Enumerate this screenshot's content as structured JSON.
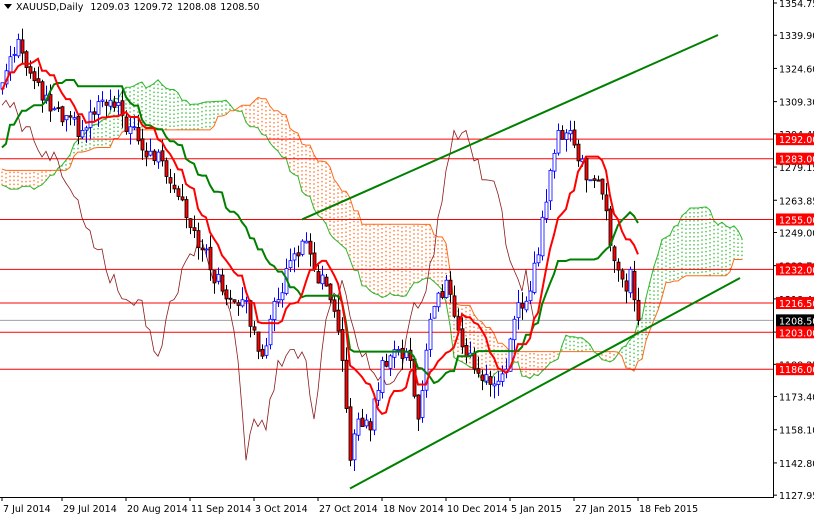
{
  "header": {
    "symbol": "XAUUSD,Daily",
    "open": "1209.03",
    "high": "1209.72",
    "low": "1208.08",
    "close": "1208.50"
  },
  "chart_data": {
    "type": "candlestick",
    "title": "XAUUSD,Daily",
    "indicator": "Ichimoku Kinko Hyo (9,26,52)",
    "ylim": [
      1127.95,
      1354.75
    ],
    "y_ticks": [
      "1354.75",
      "1339.90",
      "1324.60",
      "1309.30",
      "1294.45",
      "1279.15",
      "1263.85",
      "1249.00",
      "1233.70",
      "1218.40",
      "1203.10",
      "1188.25",
      "1173.40",
      "1158.10",
      "1142.80",
      "1127.95"
    ],
    "x_ticks": [
      {
        "bar": 0,
        "label": "7 Jul 2014"
      },
      {
        "bar": 15,
        "label": "29 Jul 2014"
      },
      {
        "bar": 31,
        "label": "20 Aug 2014"
      },
      {
        "bar": 47,
        "label": "11 Sep 2014"
      },
      {
        "bar": 63,
        "label": "3 Oct 2014"
      },
      {
        "bar": 79,
        "label": "27 Oct 2014"
      },
      {
        "bar": 95,
        "label": "18 Nov 2014"
      },
      {
        "bar": 111,
        "label": "10 Dec 2014"
      },
      {
        "bar": 127,
        "label": "5 Jan 2015"
      },
      {
        "bar": 143,
        "label": "27 Jan 2015"
      },
      {
        "bar": 159,
        "label": "18 Feb 2015"
      }
    ],
    "close_waypoints": [
      [
        -52,
        1290
      ],
      [
        -45,
        1300
      ],
      [
        -38,
        1285
      ],
      [
        -30,
        1255
      ],
      [
        -22,
        1265
      ],
      [
        -15,
        1280
      ],
      [
        -8,
        1315
      ],
      [
        -3,
        1320
      ],
      [
        0,
        1318
      ],
      [
        2,
        1330
      ],
      [
        4,
        1338
      ],
      [
        6,
        1325
      ],
      [
        10,
        1310
      ],
      [
        15,
        1300
      ],
      [
        20,
        1296
      ],
      [
        25,
        1310
      ],
      [
        30,
        1303
      ],
      [
        35,
        1287
      ],
      [
        40,
        1282
      ],
      [
        45,
        1264
      ],
      [
        50,
        1241
      ],
      [
        55,
        1222
      ],
      [
        60,
        1218
      ],
      [
        63,
        1204
      ],
      [
        65,
        1192
      ],
      [
        67,
        1209
      ],
      [
        72,
        1236
      ],
      [
        75,
        1245
      ],
      [
        78,
        1232
      ],
      [
        82,
        1218
      ],
      [
        85,
        1190
      ],
      [
        87,
        1144
      ],
      [
        89,
        1163
      ],
      [
        92,
        1158
      ],
      [
        95,
        1190
      ],
      [
        98,
        1195
      ],
      [
        102,
        1190
      ],
      [
        104,
        1163
      ],
      [
        107,
        1209
      ],
      [
        111,
        1227
      ],
      [
        114,
        1204
      ],
      [
        118,
        1186
      ],
      [
        122,
        1179
      ],
      [
        126,
        1186
      ],
      [
        128,
        1209
      ],
      [
        132,
        1222
      ],
      [
        136,
        1263
      ],
      [
        139,
        1296
      ],
      [
        142,
        1296
      ],
      [
        144,
        1282
      ],
      [
        148,
        1273
      ],
      [
        151,
        1259
      ],
      [
        153,
        1236
      ],
      [
        156,
        1222
      ],
      [
        157,
        1232
      ],
      [
        158,
        1218
      ],
      [
        159,
        1208.5
      ]
    ],
    "last_bar": 159,
    "current_price": {
      "value": 1208.5,
      "label": "1208.50",
      "color": "#000000"
    },
    "levels": [
      {
        "value": 1292.0,
        "label": "1292.00"
      },
      {
        "value": 1283.0,
        "label": "1283.00"
      },
      {
        "value": 1255.0,
        "label": "1255.00"
      },
      {
        "value": 1232.0,
        "label": "1232.00"
      },
      {
        "value": 1216.5,
        "label": "1216.50"
      },
      {
        "value": 1203.0,
        "label": "1203.00"
      },
      {
        "value": 1186.0,
        "label": "1186.00"
      }
    ],
    "trendlines": [
      {
        "name": "lower-support",
        "from": [
          87,
          1131
        ],
        "to": [
          184.5,
          1228
        ]
      },
      {
        "name": "upper-resistance",
        "from": [
          75,
          1255
        ],
        "to": [
          179,
          1340
        ]
      }
    ],
    "colors": {
      "level": "#ff0000",
      "trendline": "#008000",
      "bull": "#0000ff",
      "bear_body": "#ff0000",
      "tenkan": "#ff0000",
      "kijun": "#008000",
      "chikou": "#8b1a1a",
      "cloud_bull": "#2eb82e",
      "cloud_bear": "#ff6a1a"
    }
  }
}
